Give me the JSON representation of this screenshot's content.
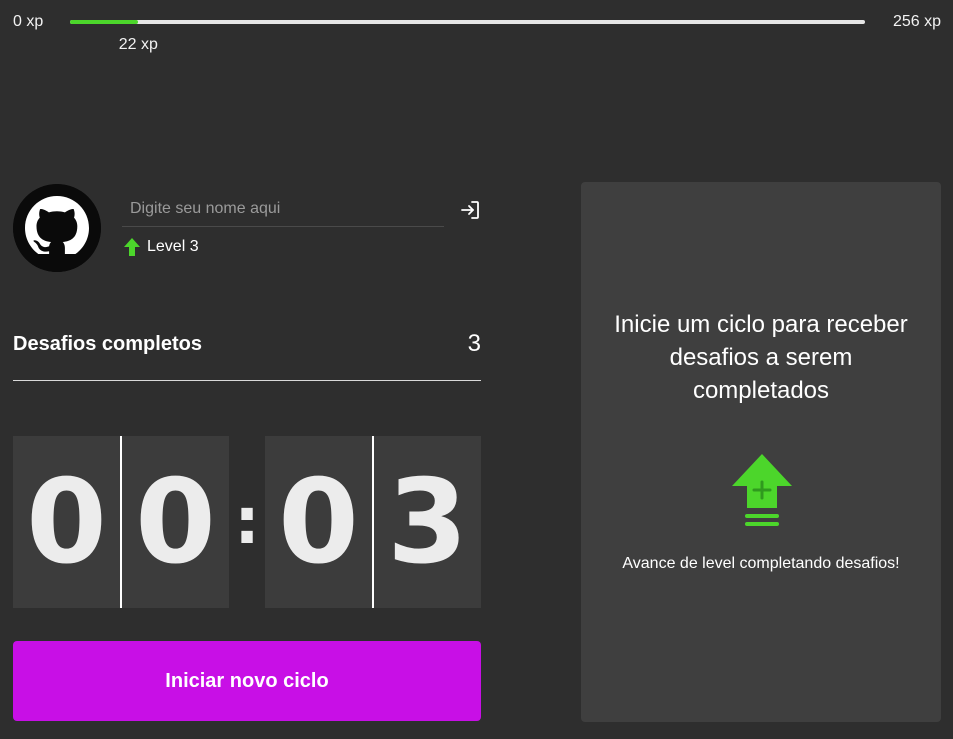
{
  "xp": {
    "min_label": "0 xp",
    "max_label": "256 xp",
    "current_label": "22 xp",
    "current": 22,
    "max": 256,
    "fill_color": "#4cd62b"
  },
  "profile": {
    "avatar_icon": "github-icon",
    "name_placeholder": "Digite seu nome aqui",
    "name_value": "",
    "login_icon": "login-icon",
    "level_icon": "level-up-arrow-icon",
    "level_label": "Level 3"
  },
  "challenges": {
    "label": "Desafios completos",
    "count": "3"
  },
  "countdown": {
    "minutes": [
      "0",
      "0"
    ],
    "separator": ":",
    "seconds": [
      "0",
      "3"
    ]
  },
  "start_button": {
    "label": "Iniciar novo ciclo",
    "color": "#c80fe6"
  },
  "challenge_card": {
    "title": "Inicie um ciclo para receber desafios a serem completados",
    "icon": "level-up-icon",
    "hint": "Avance de level completando desafios!"
  }
}
